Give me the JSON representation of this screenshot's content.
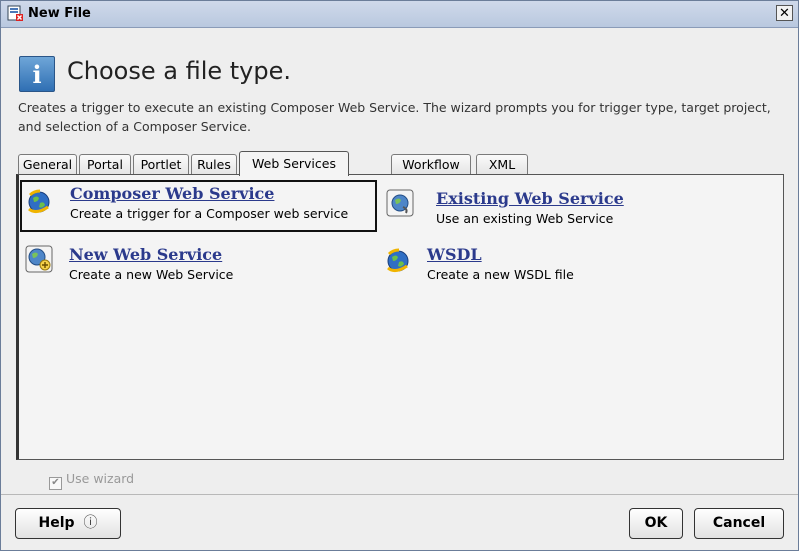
{
  "window": {
    "title": "New File",
    "app_icon": "new-file-app-icon",
    "close_glyph": "✕"
  },
  "header": {
    "icon": "info-icon",
    "icon_glyph": "i",
    "heading": "Choose a file type.",
    "description": "Creates a trigger to execute an existing Composer Web Service. The wizard prompts you for trigger type, target project, and selection of a Composer Service."
  },
  "tabs": [
    {
      "label": "General",
      "active": false
    },
    {
      "label": "Portal",
      "active": false
    },
    {
      "label": "Portlet",
      "active": false
    },
    {
      "label": "Rules",
      "active": false
    },
    {
      "label": "Web Services",
      "active": true
    },
    {
      "label": "Workflow",
      "active": false
    },
    {
      "label": "XML",
      "active": false
    }
  ],
  "items": [
    {
      "name": "Composer Web Service",
      "description": "Create a trigger for a Composer web service",
      "icon": "composer-web-service-icon",
      "selected": true
    },
    {
      "name": "Existing Web Service",
      "description": "Use an existing Web Service",
      "icon": "existing-web-service-icon",
      "selected": false
    },
    {
      "name": "New Web Service",
      "description": "Create a new Web Service",
      "icon": "new-web-service-icon",
      "selected": false
    },
    {
      "name": "WSDL",
      "description": "Create a new WSDL file",
      "icon": "wsdl-icon",
      "selected": false
    }
  ],
  "options": {
    "use_wizard_label": "Use wizard",
    "use_wizard_checked": true,
    "use_wizard_enabled": false
  },
  "buttons": {
    "help": "Help",
    "help_glyph": "ⓘ",
    "ok": "OK",
    "cancel": "Cancel"
  },
  "colors": {
    "link": "#2b3a8c",
    "titlebar": "#c4d1e6",
    "accent": "#2f6fb3"
  }
}
